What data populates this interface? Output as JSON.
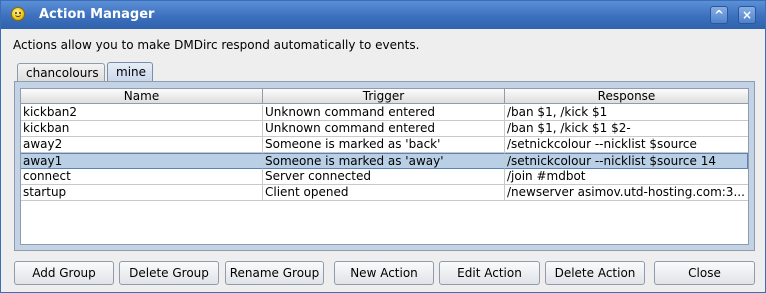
{
  "window": {
    "title": "Action Manager"
  },
  "description": "Actions allow you to make DMDirc respond automatically to events.",
  "tabs": [
    {
      "label": "chancolours",
      "selected": false
    },
    {
      "label": "mine",
      "selected": true
    }
  ],
  "table": {
    "columns": [
      "Name",
      "Trigger",
      "Response"
    ],
    "rows": [
      {
        "name": "kickban2",
        "trigger": "Unknown command entered",
        "response": "/ban $1, /kick $1",
        "selected": false
      },
      {
        "name": "kickban",
        "trigger": "Unknown command entered",
        "response": "/ban $1, /kick $1 $2-",
        "selected": false
      },
      {
        "name": "away2",
        "trigger": "Someone is marked as 'back'",
        "response": "/setnickcolour --nicklist $source",
        "selected": false
      },
      {
        "name": "away1",
        "trigger": "Someone is marked as 'away'",
        "response": "/setnickcolour --nicklist $source 14",
        "selected": true
      },
      {
        "name": "connect",
        "trigger": "Server connected",
        "response": "/join #mdbot",
        "selected": false
      },
      {
        "name": "startup",
        "trigger": "Client opened",
        "response": "/newserver asimov.utd-hosting.com:3...",
        "selected": false
      }
    ]
  },
  "buttons": {
    "add_group": "Add Group",
    "delete_group": "Delete Group",
    "rename_group": "Rename Group",
    "new_action": "New Action",
    "edit_action": "Edit Action",
    "delete_action": "Delete Action",
    "close": "Close"
  },
  "titlebar_buttons": {
    "maximize": "^",
    "close": "×"
  },
  "icons": {
    "app": "smiley-icon",
    "maximize": "chevron-up-icon",
    "close": "close-icon"
  },
  "colors": {
    "titlebar": "#3c70bd",
    "selected_row": "#b8cfe5",
    "panel": "#c4d2e6"
  }
}
